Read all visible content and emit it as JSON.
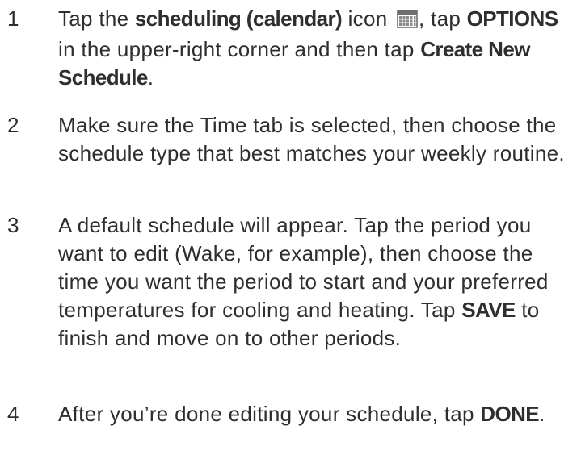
{
  "steps": [
    {
      "number": "1",
      "seg1": "Tap the ",
      "bold1": "scheduling (calendar)",
      "seg2": " icon ",
      "icon": "calendar-icon",
      "seg3": ", tap ",
      "bold2": "OPTIONS",
      "seg4": " in the upper-right corner and then tap ",
      "bold3": "Create New Schedule",
      "seg5": "."
    },
    {
      "number": "2",
      "text": "Make sure the Time tab is selected, then choose the schedule type that best matches your weekly routine."
    },
    {
      "number": "3",
      "seg1": "A default schedule will appear. Tap the period you want to edit (Wake, for example), then choose the time you want the period to start and your preferred temperatures for cooling and heating. Tap ",
      "bold1": "SAVE",
      "seg2": " to finish and move on to other periods."
    },
    {
      "number": "4",
      "seg1": "After you’re done editing your schedule, tap ",
      "bold1": "DONE",
      "seg2": "."
    }
  ]
}
